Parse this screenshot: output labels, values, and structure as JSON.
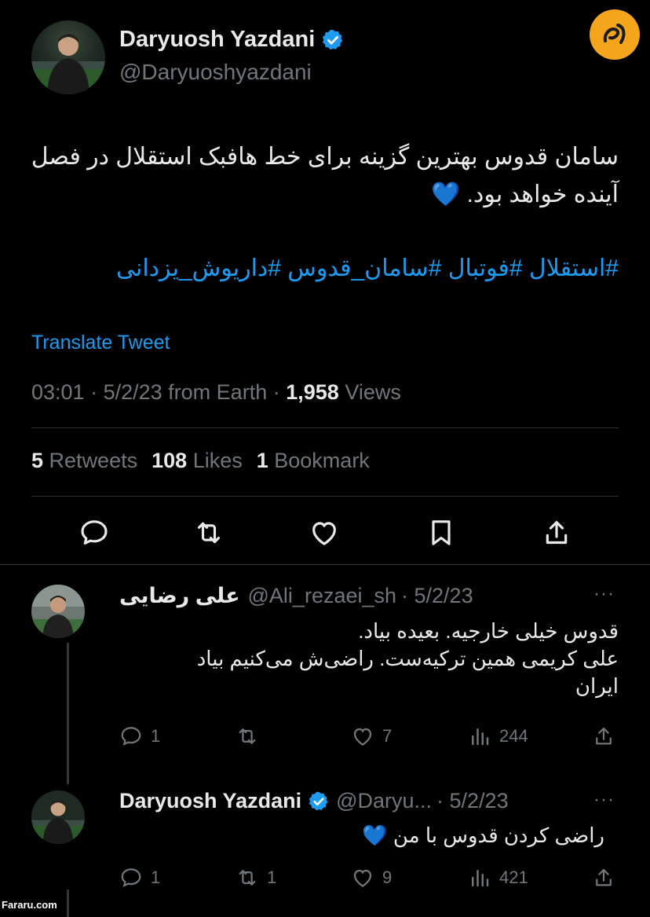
{
  "main_tweet": {
    "author_name": "Daryuosh Yazdani",
    "author_handle": "@Daryuoshyazdani",
    "text": "سامان قدوس بهترین گزینه برای خط هافبک استقلال در فصل آینده خواهد بود. 💙",
    "hashtags": "#استقلال #فوتبال #سامان_قدوس #داریوش_یزدانی",
    "translate_label": "Translate Tweet",
    "time": "03:01",
    "date": "5/2/23",
    "source": "from Earth",
    "views_count": "1,958",
    "views_label": "Views",
    "retweets_count": "5",
    "retweets_label": "Retweets",
    "likes_count": "108",
    "likes_label": "Likes",
    "bookmarks_count": "1",
    "bookmarks_label": "Bookmark",
    "actions": [
      "reply-icon",
      "retweet-icon",
      "like-icon",
      "bookmark-icon",
      "share-icon"
    ]
  },
  "replies": [
    {
      "author_name": "علی رضایی",
      "author_handle": "@Ali_rezaei_sh",
      "date": "· 5/2/23",
      "more": "···",
      "text_lines": [
        "قدوس خیلی خارجیه. بعیده بیاد.",
        "علی کریمی همین ترکیه‌ست. راضی‌ش می‌کنیم بیاد",
        "ایران"
      ],
      "reply_count": "1",
      "retweet_count": "",
      "like_count": "7",
      "view_count": "244"
    },
    {
      "author_name": "Daryuosh Yazdani",
      "author_handle": "@Daryu...",
      "date": "· 5/2/23",
      "more": "···",
      "text": "راضی کردن قدوس با من 💙",
      "reply_count": "1",
      "retweet_count": "1",
      "like_count": "9",
      "view_count": "421"
    }
  ],
  "watermark": "Fararu.com",
  "colors": {
    "background": "#000000",
    "accent_blue": "#1d9bf0",
    "muted": "#71767b",
    "text": "#e7e9ea",
    "logo": "#f4a51c"
  }
}
